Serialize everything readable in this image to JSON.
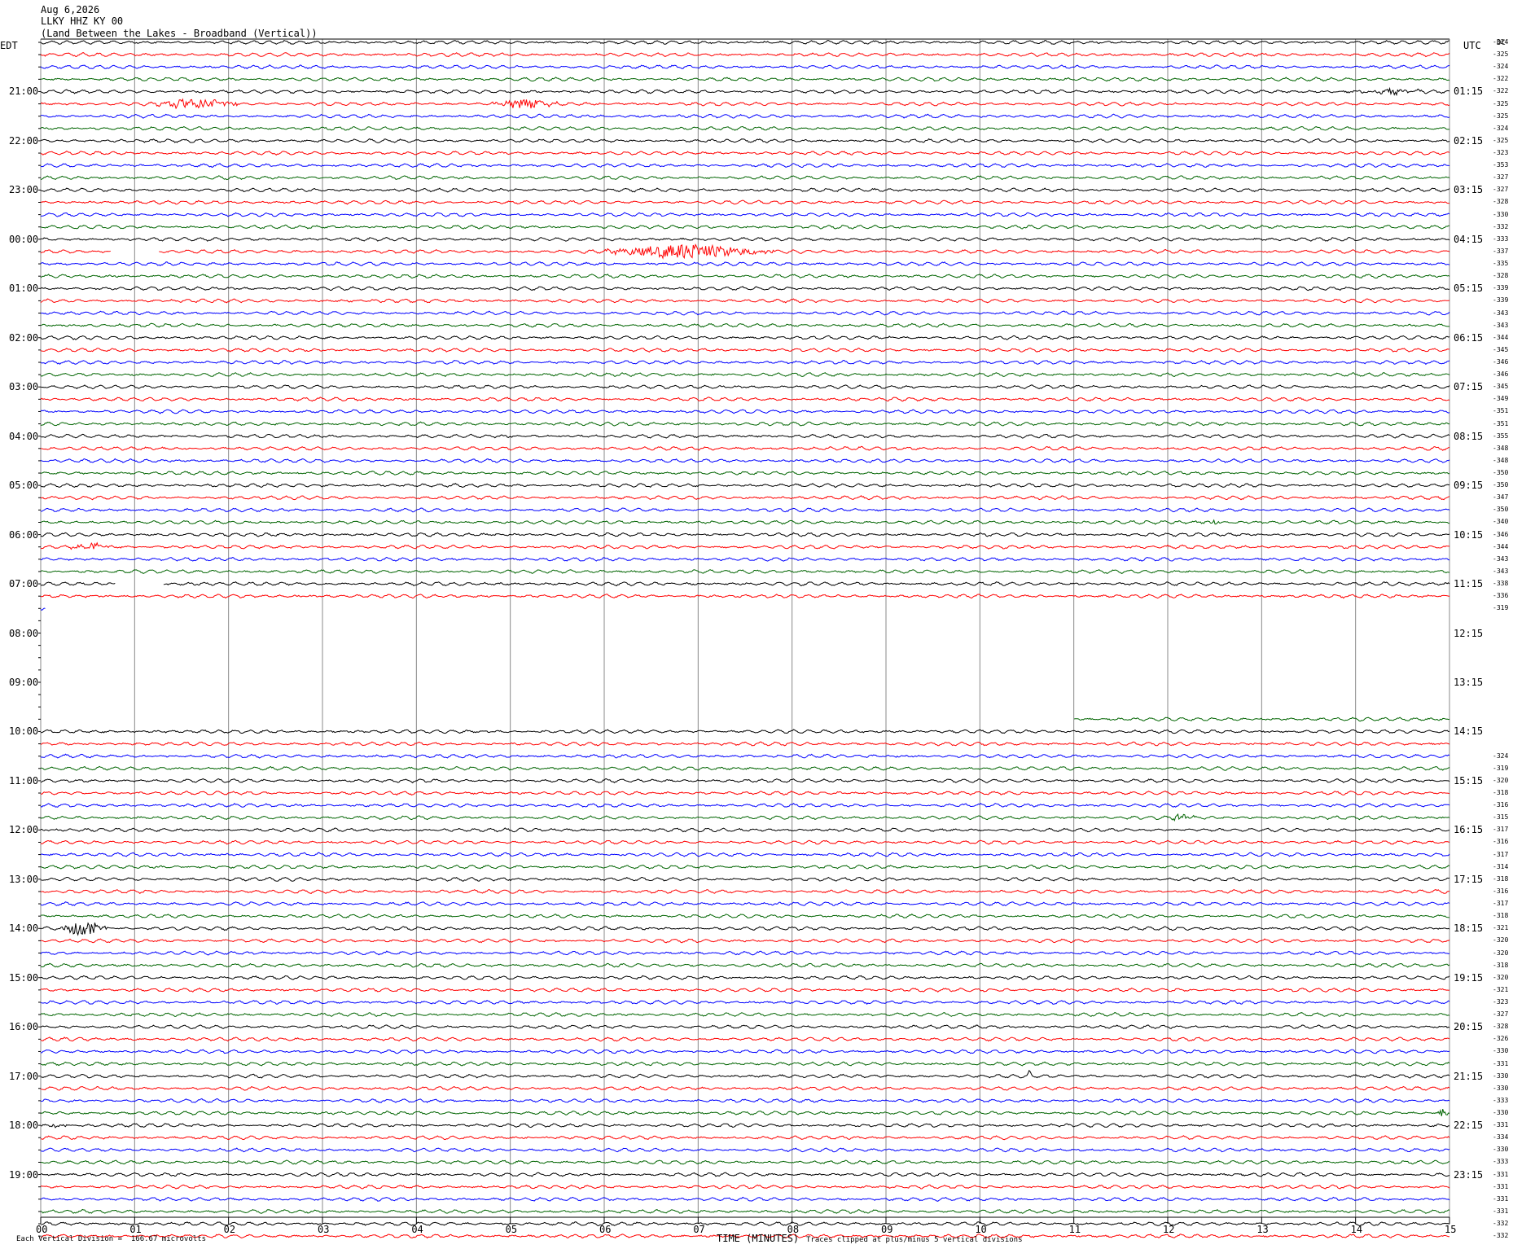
{
  "header": {
    "date": "Aug 6,2026",
    "station": "LLKY HHZ KY 00",
    "location": "(Land Between the Lakes - Broadband (Vertical))"
  },
  "left_tz": "EDT",
  "right_tz": "UTC",
  "dc_label": "DC",
  "footer": {
    "scale": "Each Vertical Division =  166.67 microvolts",
    "xlabel": "TIME (MINUTES)",
    "clip": "Traces clipped at plus/minus 5 vertical divisions"
  },
  "colors": {
    "row0": "#000000",
    "row1": "#ff0000",
    "row2": "#0000ff",
    "row3": "#006400",
    "grid": "#888888"
  },
  "chart_data": {
    "type": "line",
    "x_unit": "minutes",
    "xlim": [
      0,
      15
    ],
    "x_ticks": [
      "00",
      "01",
      "02",
      "03",
      "04",
      "05",
      "06",
      "07",
      "08",
      "09",
      "10",
      "11",
      "12",
      "13",
      "14",
      "15"
    ],
    "left_hour_labels": [
      "21:00",
      "22:00",
      "23:00",
      "00:00",
      "01:00",
      "02:00",
      "03:00",
      "04:00",
      "05:00",
      "06:00",
      "07:00",
      "08:00",
      "09:00",
      "10:00",
      "11:00",
      "12:00",
      "13:00",
      "14:00",
      "15:00",
      "16:00",
      "17:00",
      "18:00",
      "19:00"
    ],
    "right_hour_labels": [
      "01:15",
      "02:15",
      "03:15",
      "04:15",
      "05:15",
      "06:15",
      "07:15",
      "08:15",
      "09:15",
      "10:15",
      "11:15",
      "12:15",
      "13:15",
      "14:15",
      "15:15",
      "16:15",
      "17:15",
      "18:15",
      "19:15",
      "20:15",
      "21:15",
      "22:15",
      "23:15"
    ],
    "dc_offsets": [
      "-324",
      "-325",
      "-324",
      "-322",
      "-322",
      "-325",
      "-325",
      "-324",
      "-325",
      "-323",
      "-353",
      "-327",
      "-327",
      "-328",
      "-330",
      "-332",
      "-333",
      "-337",
      "-335",
      "-328",
      "-339",
      "-339",
      "-343",
      "-343",
      "-344",
      "-345",
      "-346",
      "-346",
      "-345",
      "-349",
      "-351",
      "-351",
      "-355",
      "-348",
      "-348",
      "-350",
      "-350",
      "-347",
      "-350",
      "-340",
      "-346",
      "-344",
      "-343",
      "-343",
      "-338",
      "-336",
      "-319",
      "",
      "",
      "",
      "",
      "",
      "",
      "",
      "",
      "",
      "",
      "",
      "-324",
      "-319",
      "-320",
      "-318",
      "-316",
      "-315",
      "-317",
      "-316",
      "-317",
      "-314",
      "-318",
      "-316",
      "-317",
      "-318",
      "-321",
      "-320",
      "-320",
      "-318",
      "-320",
      "-321",
      "-323",
      "-327",
      "-328",
      "-326",
      "-330",
      "-331",
      "-330",
      "-330",
      "-333",
      "-330",
      "-331",
      "-334",
      "-330",
      "-333",
      "-331",
      "-331",
      "-331",
      "-331",
      "-332",
      "-332"
    ],
    "traces_start_hour_edt": 20,
    "rows_per_hour": 4,
    "minutes_per_row": 15,
    "data_gaps": [
      {
        "row": 17,
        "from_min": 0.75,
        "to_min": 1.25
      },
      {
        "row": 44,
        "from_min": 0.8,
        "to_min": 1.3
      },
      {
        "row": 46,
        "from_min": 0.05,
        "to_min": 15
      },
      {
        "row": 47,
        "from_min": 0,
        "to_min": 15
      },
      {
        "row": 48,
        "from_min": 0,
        "to_min": 15
      },
      {
        "row": 49,
        "from_min": 0,
        "to_min": 15
      },
      {
        "row": 50,
        "from_min": 0,
        "to_min": 15
      },
      {
        "row": 51,
        "from_min": 0,
        "to_min": 15
      },
      {
        "row": 52,
        "from_min": 0,
        "to_min": 15
      },
      {
        "row": 53,
        "from_min": 0,
        "to_min": 15
      },
      {
        "row": 54,
        "from_min": 0,
        "to_min": 15
      },
      {
        "row": 55,
        "from_min": 0,
        "to_min": 11
      }
    ],
    "events": [
      {
        "row": 5,
        "start_min": 1.2,
        "end_min": 2.1,
        "amp": 2.0
      },
      {
        "row": 5,
        "start_min": 4.8,
        "end_min": 5.5,
        "amp": 1.8
      },
      {
        "row": 4,
        "start_min": 13.9,
        "end_min": 14.9,
        "amp": 0.8
      },
      {
        "row": 17,
        "start_min": 6.0,
        "end_min": 7.8,
        "amp": 2.6
      },
      {
        "row": 39,
        "start_min": 12.3,
        "end_min": 12.6,
        "amp": 0.8
      },
      {
        "row": 41,
        "start_min": 0.3,
        "end_min": 0.8,
        "amp": 1.2
      },
      {
        "row": 63,
        "start_min": 12.0,
        "end_min": 12.3,
        "amp": 1.4
      },
      {
        "row": 72,
        "start_min": 0.2,
        "end_min": 0.7,
        "amp": 3.0
      },
      {
        "row": 84,
        "start_min": 10.5,
        "end_min": 10.55,
        "amp": 1.6
      },
      {
        "row": 87,
        "start_min": 14.85,
        "end_min": 15.0,
        "amp": 1.6
      },
      {
        "row": 88,
        "start_min": 0.0,
        "end_min": 0.3,
        "amp": 1.0
      }
    ]
  }
}
